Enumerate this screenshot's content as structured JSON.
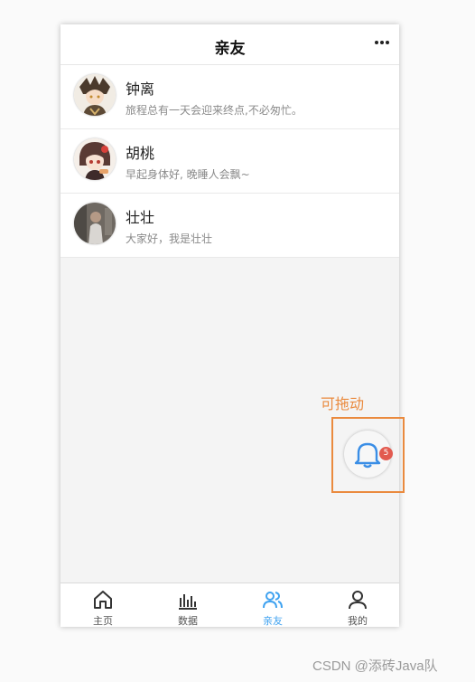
{
  "header": {
    "title": "亲友",
    "menu_icon": "more-dots-icon"
  },
  "contacts": [
    {
      "name": "钟离",
      "signature": "旅程总有一天会迎来终点,不必匆忙。"
    },
    {
      "name": "胡桃",
      "signature": "早起身体好, 晚睡人会飘~"
    },
    {
      "name": "壮壮",
      "signature": "大家好，我是壮壮"
    }
  ],
  "floating": {
    "label": "可拖动",
    "badge_count": "5",
    "icon": "bell-icon"
  },
  "tabs": [
    {
      "label": "主页",
      "icon": "home-icon",
      "active": false
    },
    {
      "label": "数据",
      "icon": "chart-icon",
      "active": false
    },
    {
      "label": "亲友",
      "icon": "friends-icon",
      "active": true
    },
    {
      "label": "我的",
      "icon": "user-icon",
      "active": false
    }
  ],
  "watermark": "CSDN @添砖Java队",
  "colors": {
    "accent": "#3fa2f0",
    "badge": "#e25a4f",
    "highlight": "#ea8a3e"
  }
}
